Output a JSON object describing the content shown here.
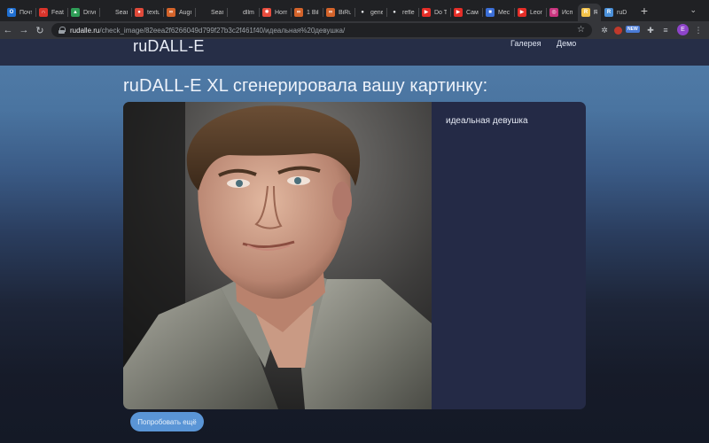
{
  "browser": {
    "tabs": [
      {
        "label": "Почт",
        "icon": "outlook-icon",
        "color": "#1f6fd1",
        "glyph": "O"
      },
      {
        "label": "Featu",
        "icon": "ribbon-icon",
        "color": "#d9342b",
        "glyph": "∩"
      },
      {
        "label": "Drive",
        "icon": "drive-icon",
        "color": "#2f9e57",
        "glyph": "▲"
      },
      {
        "label": "Sear",
        "icon": "search-icon",
        "color": "#5f6368",
        "glyph": ""
      },
      {
        "label": "textu",
        "icon": "textual-inversion-icon",
        "color": "#e04a3a",
        "glyph": "●"
      },
      {
        "label": "Augr",
        "icon": "infinity-icon",
        "color": "#d4632a",
        "glyph": "∞"
      },
      {
        "label": "Sear",
        "icon": "search-icon",
        "color": "#5f6368",
        "glyph": ""
      },
      {
        "label": "dllm",
        "icon": "generic-page-icon",
        "color": "#5f6368",
        "glyph": ""
      },
      {
        "label": "Hom",
        "icon": "hub-icon",
        "color": "#e84c3d",
        "glyph": "✺"
      },
      {
        "label": "1 Bil",
        "icon": "infinity-icon",
        "color": "#d4632a",
        "glyph": "∞"
      },
      {
        "label": "BiRu",
        "icon": "infinity-icon",
        "color": "#d4632a",
        "glyph": "∞"
      },
      {
        "label": "gene",
        "icon": "github-icon",
        "color": "#e8eaed",
        "glyph": "●"
      },
      {
        "label": "refle",
        "icon": "github-icon",
        "color": "#e8eaed",
        "glyph": "●"
      },
      {
        "label": "Do T",
        "icon": "youtube-icon",
        "color": "#e52d27",
        "glyph": "▶"
      },
      {
        "label": "Сам",
        "icon": "youtube-icon",
        "color": "#e52d27",
        "glyph": "▶"
      },
      {
        "label": "Мес",
        "icon": "messenger-icon",
        "color": "#3b6fd8",
        "glyph": "■"
      },
      {
        "label": "Leon",
        "icon": "youtube-icon",
        "color": "#e52d27",
        "glyph": "▶"
      },
      {
        "label": "Исп",
        "icon": "instagram-icon",
        "color": "#c9357f",
        "glyph": "◎"
      },
      {
        "label": "R",
        "icon": "rudalle-icon",
        "color": "#f3c34a",
        "glyph": "R",
        "active": true
      },
      {
        "label": "ruD",
        "icon": "rudalle-icon",
        "color": "#4a90d9",
        "glyph": "R"
      }
    ],
    "url_host": "rudalle.ru",
    "url_path": "/check_image/82eea2f6266049d799f27b3c2f461f40/идеальная%20девушка/",
    "new_badge": "NEW",
    "profile_initial": "E"
  },
  "site": {
    "logo": "ruDALL-E",
    "nav": [
      "Галерея",
      "Демо"
    ],
    "heading": "ruDALL-E XL сгенерировала вашу картинку:",
    "prompt": "идеальная девушка",
    "try_again": "Попробовать ещё"
  },
  "colors": {
    "card_bg": "#242a46",
    "button_bg": "#5a95d6"
  }
}
